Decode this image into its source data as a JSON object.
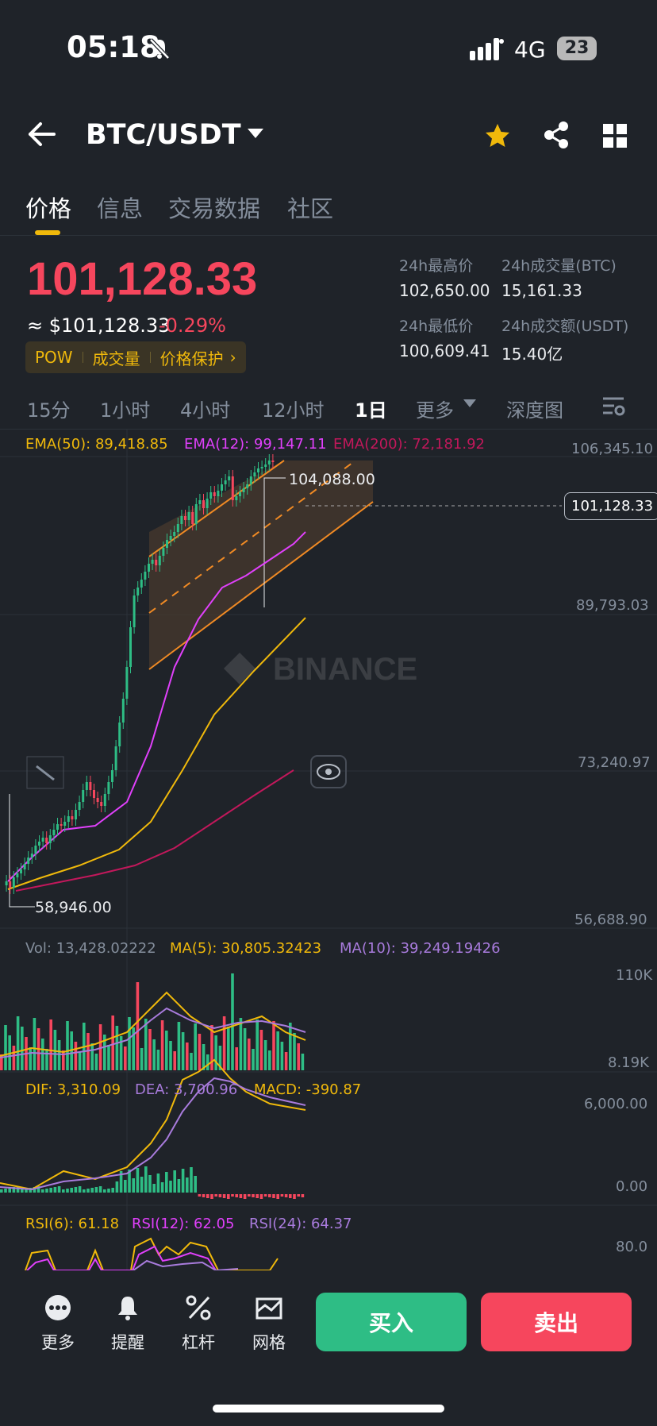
{
  "status_bar": {
    "time": "05:18",
    "network": "4G",
    "battery": "23"
  },
  "header": {
    "pair": "BTC/USDT"
  },
  "tabs": [
    "价格",
    "信息",
    "交易数据",
    "社区"
  ],
  "price": {
    "last": "101,128.33",
    "usd_value": "≈ $101,128.33",
    "change": "-0.29%",
    "tags": [
      "POW",
      "成交量",
      "价格保护"
    ]
  },
  "stats": {
    "high_label": "24h最高价",
    "high": "102,650.00",
    "vol_btc_label": "24h成交量(BTC)",
    "vol_btc": "15,161.33",
    "low_label": "24h最低价",
    "low": "100,609.41",
    "vol_usdt_label": "24h成交额(USDT)",
    "vol_usdt": "15.40亿"
  },
  "intervals": [
    "15分",
    "1小时",
    "4小时",
    "12小时",
    "1日",
    "更多",
    "深度图"
  ],
  "active_interval": "1日",
  "indicators": {
    "ema50": "EMA(50): 89,418.85",
    "ema12": "EMA(12): 99,147.11",
    "ema200": "EMA(200): 72,181.92",
    "vol": "Vol: 13,428.02222",
    "ma5": "MA(5): 30,805.32423",
    "ma10": "MA(10): 39,249.19426",
    "dif": "DIF: 3,310.09",
    "dea": "DEA: 3,700.96",
    "macd": "MACD: -390.87",
    "rsi6": "RSI(6): 61.18",
    "rsi12": "RSI(12): 62.05",
    "rsi24": "RSI(24): 64.37"
  },
  "chart_axis": {
    "price_ticks": [
      "106,345.10",
      "89,793.03",
      "73,240.97",
      "56,688.90"
    ],
    "current_price_tag": "101,128.33",
    "high_marker": "104,088.00",
    "low_marker": "58,946.00",
    "vol_ticks": [
      "110K",
      "8.19K"
    ],
    "macd_ticks": [
      "6,000.00",
      "0.00"
    ],
    "rsi_ticks": [
      "80.0"
    ]
  },
  "watermark": "BINANCE",
  "bottom_nav": [
    "更多",
    "提醒",
    "杠杆",
    "网格"
  ],
  "actions": {
    "buy": "买入",
    "sell": "卖出"
  },
  "colors": {
    "up": "#2ebd85",
    "down": "#f6465d",
    "accent": "#f0b90b",
    "ema50": "#f0b90b",
    "ema12": "#e040fb",
    "ema200": "#c2185b",
    "ma10": "#a87bdc"
  }
}
